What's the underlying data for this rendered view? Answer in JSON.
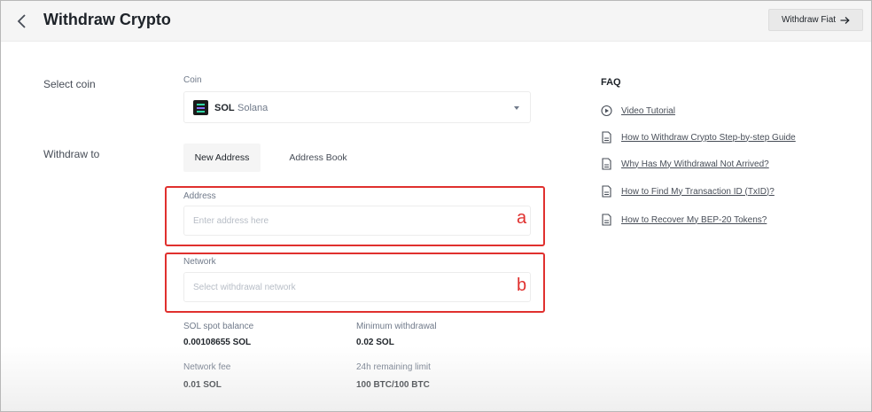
{
  "header": {
    "title": "Withdraw Crypto",
    "fiat_button": "Withdraw Fiat"
  },
  "form": {
    "select_coin_label": "Select coin",
    "withdraw_to_label": "Withdraw to",
    "coin_caption": "Coin",
    "coin_symbol": "SOL",
    "coin_name": "Solana",
    "tabs": [
      {
        "label": "New Address",
        "active": true
      },
      {
        "label": "Address Book",
        "active": false
      }
    ],
    "address_caption": "Address",
    "address_placeholder": "Enter address here",
    "network_caption": "Network",
    "network_placeholder": "Select withdrawal network"
  },
  "annotations": {
    "a": "a",
    "b": "b",
    "color": "#e0302e"
  },
  "info": {
    "balance_label": "SOL spot balance",
    "balance_value": "0.00108655 SOL",
    "min_label": "Minimum withdrawal",
    "min_value": "0.02 SOL",
    "fee_label": "Network fee",
    "fee_value": "0.01 SOL",
    "limit_label": "24h remaining limit",
    "limit_value": "100 BTC/100 BTC"
  },
  "faq": {
    "title": "FAQ",
    "items": [
      {
        "label": "Video Tutorial",
        "icon": "play-circle-icon"
      },
      {
        "label": "How to Withdraw Crypto Step-by-step Guide",
        "icon": "document-icon"
      },
      {
        "label": "Why Has My Withdrawal Not Arrived?",
        "icon": "document-icon"
      },
      {
        "label": "How to Find My Transaction ID (TxID)?",
        "icon": "document-icon"
      },
      {
        "label": "How to Recover My BEP-20 Tokens?",
        "icon": "document-icon"
      }
    ]
  },
  "colors": {
    "accent_red": "#e0302e",
    "header_bg": "#f5f5f5",
    "text_primary": "#1e2329",
    "text_secondary": "#707a8a"
  }
}
